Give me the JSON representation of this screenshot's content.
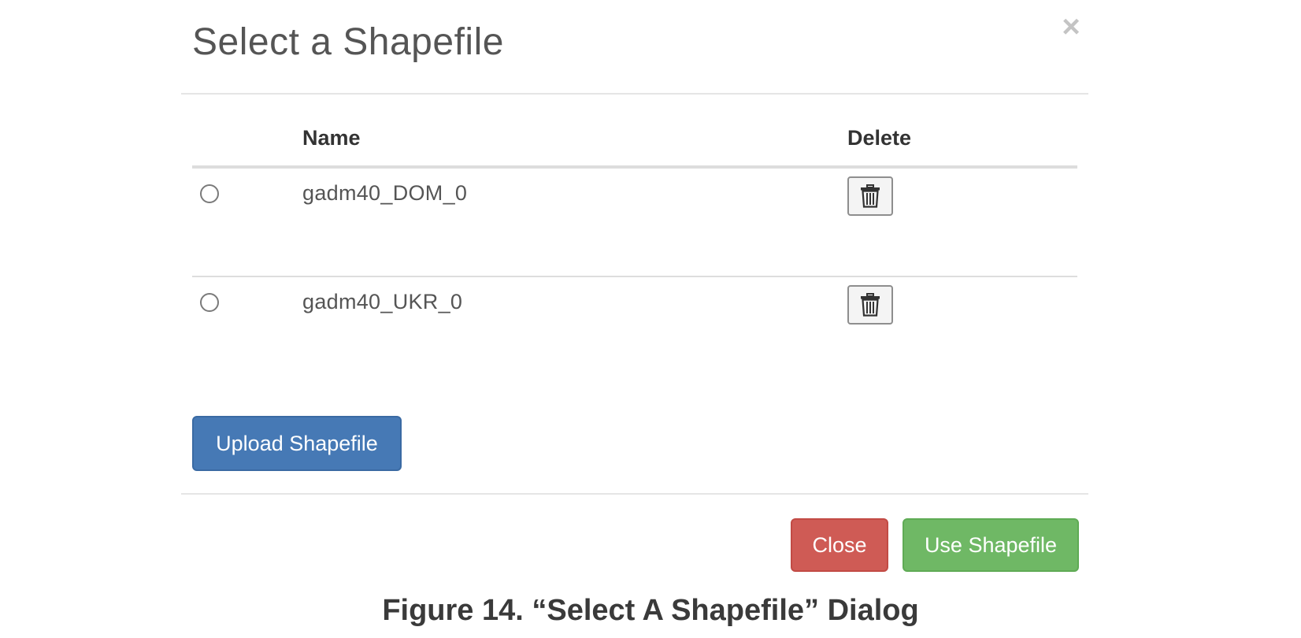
{
  "dialog": {
    "title": "Select a Shapefile",
    "close_glyph": "×"
  },
  "table": {
    "columns": {
      "name": "Name",
      "delete": "Delete"
    },
    "rows": [
      {
        "name": "gadm40_DOM_0",
        "selected": false
      },
      {
        "name": "gadm40_UKR_0",
        "selected": false
      }
    ]
  },
  "actions": {
    "upload_label": "Upload Shapefile",
    "close_label": "Close",
    "use_label": "Use Shapefile"
  },
  "caption": "Figure 14. “Select A Shapefile” Dialog",
  "colors": {
    "primary": "#4679b5",
    "danger": "#cf5b55",
    "success": "#6fb865"
  },
  "icons": {
    "close": "close-icon",
    "delete": "trash-icon"
  }
}
